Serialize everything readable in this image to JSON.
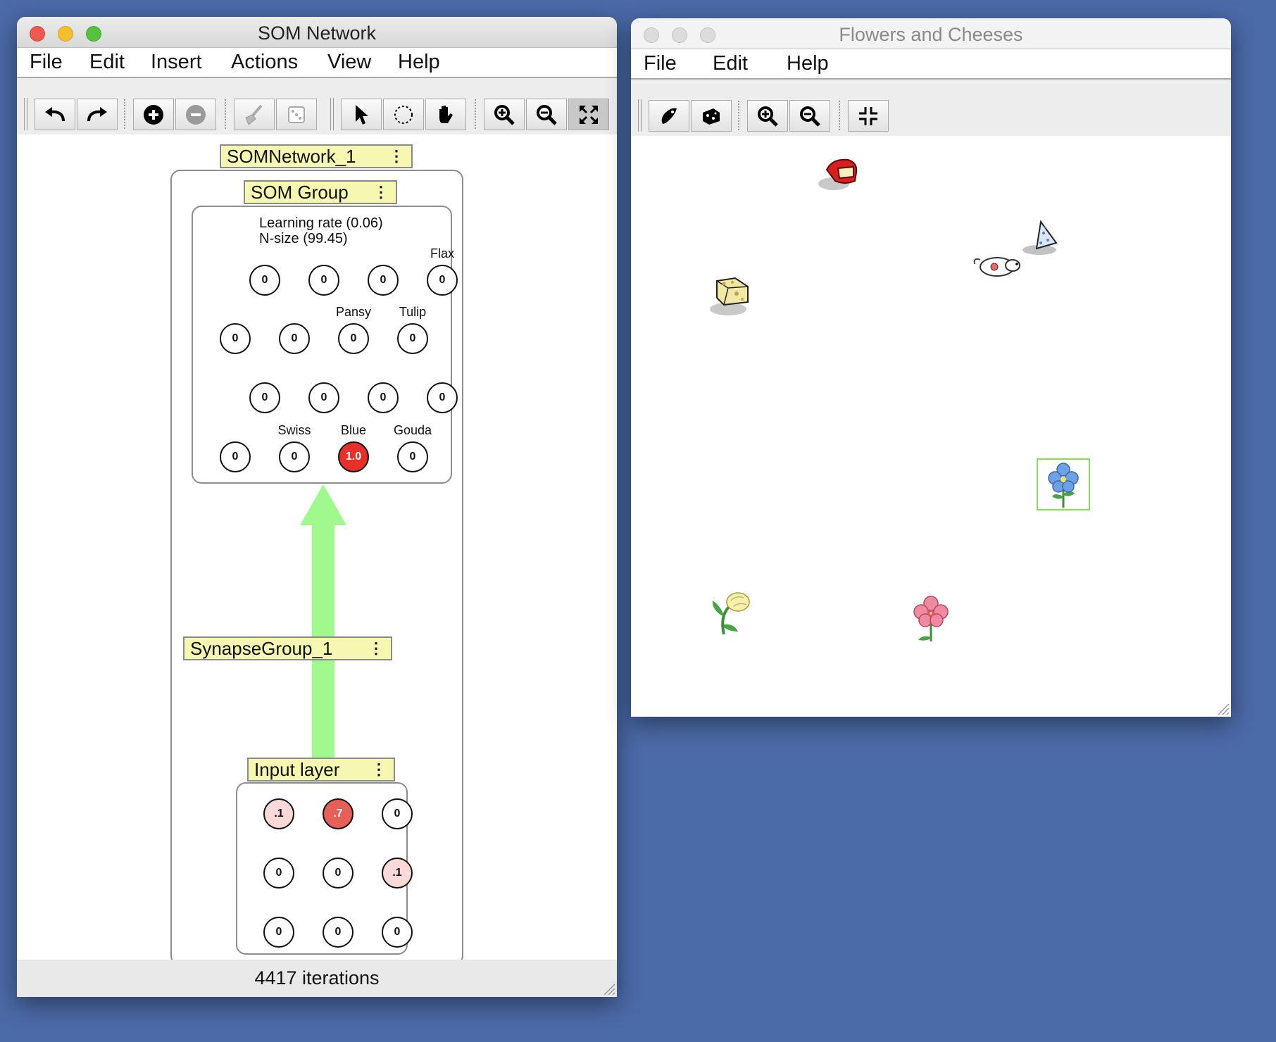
{
  "som_window": {
    "title": "SOM Network",
    "menu": [
      "File",
      "Edit",
      "Insert",
      "Actions",
      "View",
      "Help"
    ],
    "toolbar_icons": [
      "undo-icon",
      "redo-icon",
      "add-neuron-icon",
      "remove-neuron-icon",
      "clear-icon",
      "randomize-icon",
      "select-icon",
      "lasso-icon",
      "pan-icon",
      "zoom-in-icon",
      "zoom-out-icon",
      "fit-to-screen-icon"
    ],
    "network_label": "SOMNetwork_1",
    "som_group_label": "SOM Group",
    "learning_rate": "Learning rate (0.06)",
    "n_size": "N-size (99.45)",
    "som_rows": [
      {
        "neurons": [
          {
            "value": "0",
            "label": ""
          },
          {
            "value": "0",
            "label": ""
          },
          {
            "value": "0",
            "label": ""
          },
          {
            "value": "0",
            "label": "Flax"
          }
        ]
      },
      {
        "neurons": [
          {
            "value": "0",
            "label": ""
          },
          {
            "value": "0",
            "label": ""
          },
          {
            "value": "0",
            "label": "Pansy"
          },
          {
            "value": "0",
            "label": "Tulip"
          }
        ]
      },
      {
        "neurons": [
          {
            "value": "0",
            "label": ""
          },
          {
            "value": "0",
            "label": ""
          },
          {
            "value": "0",
            "label": ""
          },
          {
            "value": "0",
            "label": ""
          }
        ]
      },
      {
        "neurons": [
          {
            "value": "0",
            "label": ""
          },
          {
            "value": "0",
            "label": "Swiss"
          },
          {
            "value": "1.0",
            "label": "Blue"
          },
          {
            "value": "0",
            "label": "Gouda"
          }
        ]
      }
    ],
    "synapse_label": "SynapseGroup_1",
    "input_label": "Input layer",
    "input_rows": [
      [
        "0.1",
        ".7",
        "0"
      ],
      [
        "0",
        "0",
        ".1"
      ],
      [
        "0",
        "0",
        "0"
      ]
    ],
    "input_display": [
      [
        ".1",
        ".7",
        "0"
      ],
      [
        "0",
        "0",
        ".1"
      ],
      [
        "0",
        "0",
        "0"
      ]
    ],
    "status": "4417 iterations"
  },
  "world_window": {
    "title": "Flowers and Cheeses",
    "menu": [
      "File",
      "Edit",
      "Help"
    ],
    "toolbar_icons": [
      "add-agent-icon",
      "add-entity-icon",
      "zoom-in-icon",
      "zoom-out-icon",
      "fit-icon"
    ],
    "objects": [
      "red-cheese-icon",
      "blue-cheese-icon",
      "mouse-icon",
      "swiss-cheese-icon",
      "blue-flower-icon",
      "yellow-tulip-icon",
      "pink-flower-icon"
    ]
  },
  "colors": {
    "active_neuron": "#e8302a",
    "weak_activation": "#fbd9d9",
    "mid_activation": "#e76058",
    "synapse_arrow": "#a1f98e",
    "label_bg": "#f6f8b2",
    "desktop": "#4b6aa8"
  }
}
